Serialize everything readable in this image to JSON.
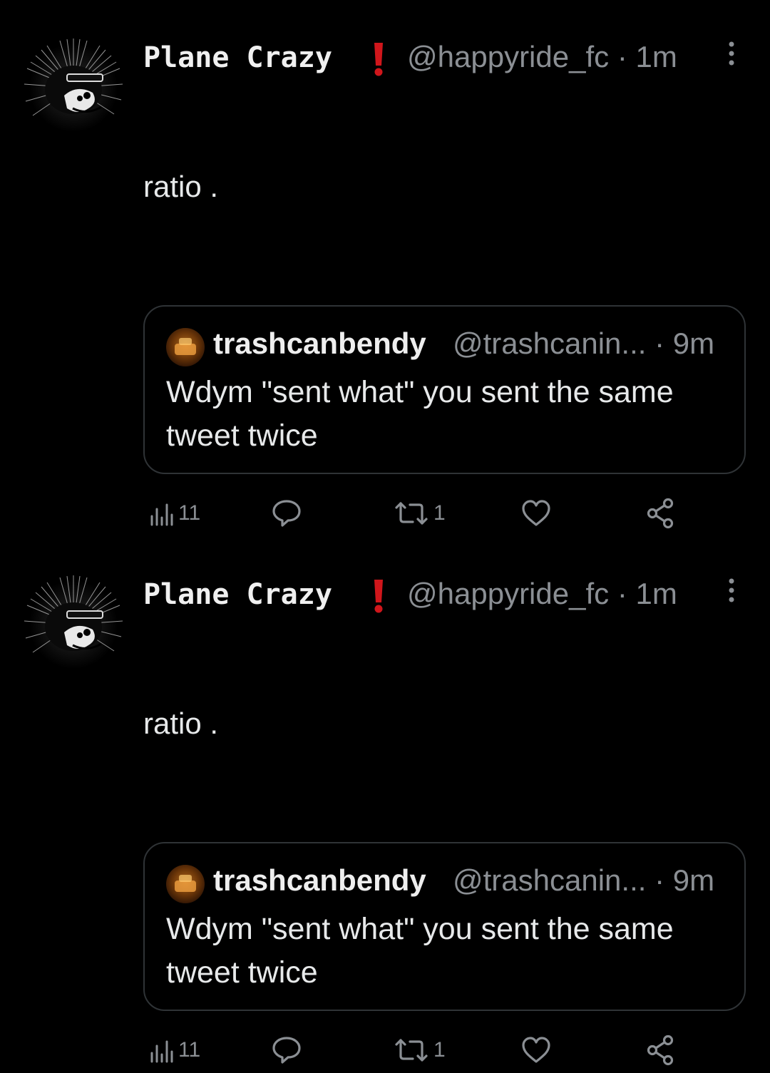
{
  "tweets": [
    {
      "author_name": "Plane Crazy",
      "badge_icon": "exclamation-icon",
      "handle": "@happyride_fc",
      "separator": "·",
      "time": "1m",
      "text": "ratio .",
      "quoted": {
        "author_name": "trashcanbendy",
        "handle": "@trashcanin...",
        "separator": "·",
        "time": "9m",
        "text": "Wdym \"sent what\" you sent the same tweet twice"
      },
      "actions": {
        "views": "11",
        "reply": "",
        "retweets": "1",
        "likes": "",
        "share": ""
      }
    },
    {
      "author_name": "Plane Crazy",
      "badge_icon": "exclamation-icon",
      "handle": "@happyride_fc",
      "separator": "·",
      "time": "1m",
      "text": "ratio .",
      "quoted": {
        "author_name": "trashcanbendy",
        "handle": "@trashcanin...",
        "separator": "·",
        "time": "9m",
        "text": "Wdym \"sent what\" you sent the same tweet twice"
      },
      "actions": {
        "views": "11",
        "reply": "",
        "retweets": "1",
        "likes": "",
        "share": ""
      }
    }
  ],
  "colors": {
    "background": "#000000",
    "text": "#e7e9ea",
    "muted": "#8b8f94",
    "badge": "#d0161b",
    "border": "#2f3336"
  }
}
